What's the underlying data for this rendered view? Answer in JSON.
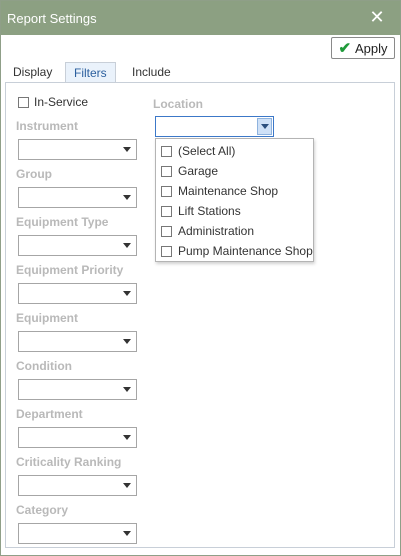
{
  "window": {
    "title": "Report Settings"
  },
  "toolbar": {
    "apply_label": "Apply"
  },
  "tabs": [
    {
      "label": "Display",
      "active": false
    },
    {
      "label": "Filters",
      "active": true
    },
    {
      "label": "Include",
      "active": false
    }
  ],
  "filters": {
    "in_service_label": "In-Service",
    "fields": [
      {
        "label": "Instrument",
        "value": ""
      },
      {
        "label": "Group",
        "value": ""
      },
      {
        "label": "Equipment Type",
        "value": ""
      },
      {
        "label": "Equipment Priority",
        "value": ""
      },
      {
        "label": "Equipment",
        "value": ""
      },
      {
        "label": "Condition",
        "value": ""
      },
      {
        "label": "Department",
        "value": ""
      },
      {
        "label": "Criticality Ranking",
        "value": ""
      },
      {
        "label": "Category",
        "value": ""
      }
    ],
    "location": {
      "label": "Location",
      "value": "",
      "options": [
        "(Select All)",
        "Garage",
        "Maintenance Shop",
        "Lift Stations",
        "Administration",
        "Pump Maintenance Shop"
      ]
    }
  },
  "colors": {
    "titlebar": "#8ca082",
    "active_tab_text": "#2b5f9e",
    "label_gray": "#b9b9b9",
    "apply_check": "#1f9a3a"
  }
}
